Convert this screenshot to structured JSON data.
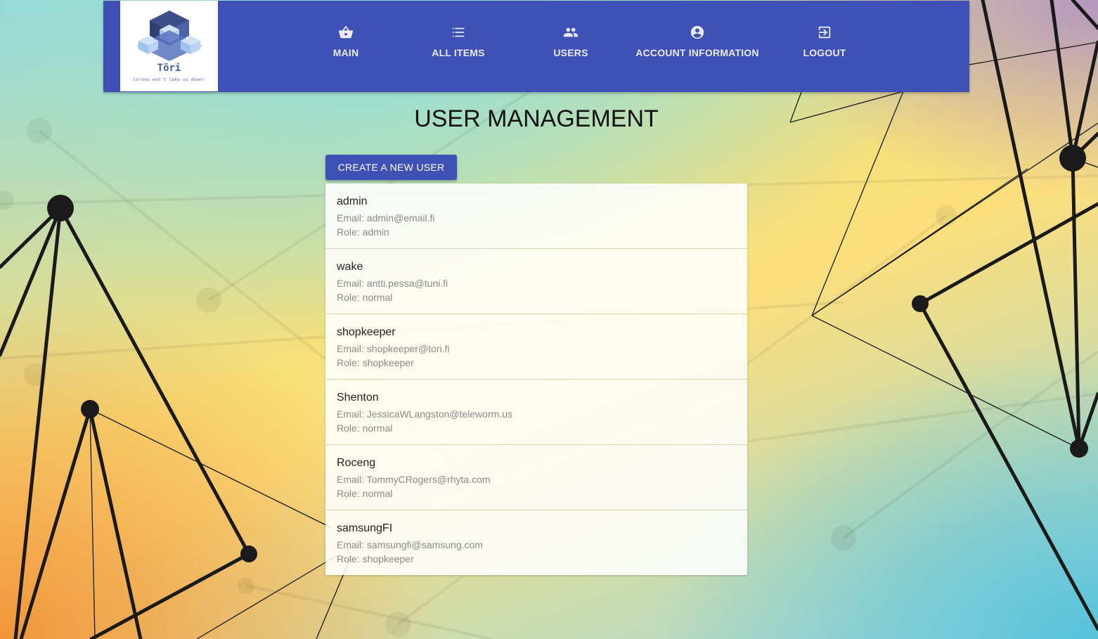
{
  "nav": {
    "logo": {
      "title": "Töri",
      "tagline": "Corona won't take us down!"
    },
    "items": [
      {
        "label": "MAIN",
        "icon": "basket-icon"
      },
      {
        "label": "ALL ITEMS",
        "icon": "list-icon"
      },
      {
        "label": "USERS",
        "icon": "people-icon"
      },
      {
        "label": "ACCOUNT INFORMATION",
        "icon": "account-circle-icon"
      },
      {
        "label": "LOGOUT",
        "icon": "logout-icon"
      }
    ]
  },
  "main": {
    "title": "USER MANAGEMENT",
    "create_button": "CREATE A NEW USER",
    "users": [
      {
        "name": "admin",
        "email": "Email: admin@email.fi",
        "role": "Role: admin"
      },
      {
        "name": "wake",
        "email": "Email: antti.pessa@tuni.fi",
        "role": "Role: normal"
      },
      {
        "name": "shopkeeper",
        "email": "Email: shopkeeper@tori.fi",
        "role": "Role: shopkeeper"
      },
      {
        "name": "Shenton",
        "email": "Email: JessicaWLangston@teleworm.us",
        "role": "Role: normal"
      },
      {
        "name": "Roceng",
        "email": "Email: TommyCRogers@rhyta.com",
        "role": "Role: normal"
      },
      {
        "name": "samsungFI",
        "email": "Email: samsungfi@samsung.com",
        "role": "Role: shopkeeper"
      }
    ]
  },
  "colors": {
    "primary": "#3f51b5"
  }
}
